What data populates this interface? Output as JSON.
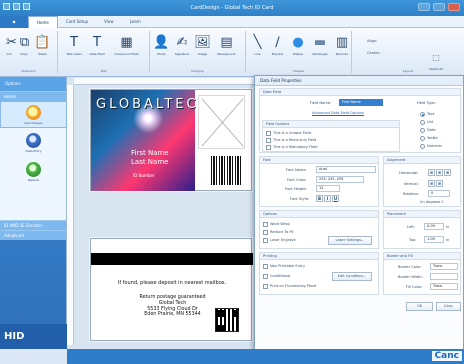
{
  "window": {
    "title": "CardDesign - Global Tech ID Card",
    "controls": [
      "minimize",
      "maximize",
      "close"
    ]
  },
  "tabs": [
    "Home",
    "Card Setup",
    "View",
    "Learn"
  ],
  "ribbon": {
    "groups": {
      "clipboard": "Clipboard",
      "text": "Text",
      "imaging": "Imaging",
      "shapes": "Shapes",
      "encode": "Encode",
      "layout": "Layout"
    },
    "tools": [
      {
        "label": "Cut",
        "icon": "scissors-icon"
      },
      {
        "label": "Copy",
        "icon": "copy-icon"
      },
      {
        "label": "Paste",
        "icon": "paste-icon"
      },
      {
        "label": "Text Label",
        "icon": "text-label-icon"
      },
      {
        "label": "Data Field",
        "icon": "data-field-icon"
      },
      {
        "label": "Compound Field",
        "icon": "compound-field-icon"
      },
      {
        "label": "Photo",
        "icon": "photo-icon"
      },
      {
        "label": "Signature",
        "icon": "signature-icon"
      },
      {
        "label": "Image",
        "icon": "image-icon"
      },
      {
        "label": "Background",
        "icon": "background-icon"
      },
      {
        "label": "Line",
        "icon": "line-icon"
      },
      {
        "label": "Polyline",
        "icon": "polyline-icon"
      },
      {
        "label": "Ellipse",
        "icon": "ellipse-icon"
      },
      {
        "label": "Rectangle",
        "icon": "rectangle-icon"
      },
      {
        "label": "Barcode",
        "icon": "barcode-icon"
      },
      {
        "label": "Select All",
        "icon": "select-all-icon"
      }
    ],
    "align_label": "Align:",
    "center_label": "Center:"
  },
  "sidebar": {
    "title": "Options",
    "section_home": "Home",
    "modes": [
      {
        "label": "Card Design",
        "color": "#f1b52d"
      },
      {
        "label": "Data Entry",
        "color": "#3d73c5"
      },
      {
        "label": "Reports",
        "color": "#53b648"
      }
    ],
    "section_encoder": "ID AND SE Encoder",
    "section_advanced": "Advanced",
    "brand": "HID"
  },
  "card": {
    "front": {
      "company": "GLOBALTECH",
      "first_name": "First Name",
      "last_name": "Last Name",
      "id_number": "ID Number"
    },
    "back": {
      "return_text": "If found, please deposit in nearest mailbox.",
      "postage": "Return postage guaranteed",
      "address_1": "Global Tech",
      "address_2": "5533 Flying Cloud Dr",
      "address_3": "Eden Prairie, MN 55344"
    }
  },
  "dialog": {
    "title": "Data Field Properties",
    "data_field": {
      "section": "Data Field",
      "field_name_label": "Field Name:",
      "field_name_value": "First Name",
      "advanced_link": "Advanced Data Field Options",
      "field_type_label": "Field Type:",
      "field_types": [
        "Text",
        "List",
        "Date",
        "YesNo",
        "Numeric"
      ],
      "options_section": "Field Options",
      "options": [
        "This is a Unique Field",
        "This is a Read-only Field",
        "This is a Mandatory Field"
      ]
    },
    "font": {
      "section": "Font",
      "name_label": "Font Name:",
      "name_value": "Arial",
      "color_label": "Font Color:",
      "color_value": "255, 255, 255",
      "height_label": "Font Height:",
      "height_value": "12",
      "style_label": "Font Style:",
      "styles": [
        "B",
        "I",
        "U"
      ]
    },
    "alignment": {
      "section": "Alignment",
      "horizontal_label": "Horizontal:",
      "vertical_label": "Vertical:",
      "rotation_label": "Rotation:",
      "rotation_value": "0",
      "degrees_label": "(in degrees C"
    },
    "options": {
      "section": "Options",
      "word_wrap": "Word Wrap",
      "reduce_to_fit": "Reduce To Fit",
      "laser_engrave": "Laser Engrave",
      "laser_settings": "Laser Settings..."
    },
    "printing": {
      "section": "Printing",
      "non_printable": "Non Printable Entry",
      "conditional": "Conditional",
      "edit_condition": "Edit Condition...",
      "fluorescing": "Print on Fluorescing Panel"
    },
    "placement": {
      "section": "Placement",
      "left_label": "Left:",
      "left_value": "0.09",
      "top_label": "Top:",
      "top_value": "1.00",
      "unit": "in"
    },
    "border_fill": {
      "section": "Border and Fill",
      "border_color_label": "Border Color:",
      "border_width_label": "Border Width:",
      "fill_color_label": "Fill Color:",
      "transparent": "Trans"
    },
    "buttons": {
      "ok": "OK",
      "cancel": "Canc"
    }
  }
}
